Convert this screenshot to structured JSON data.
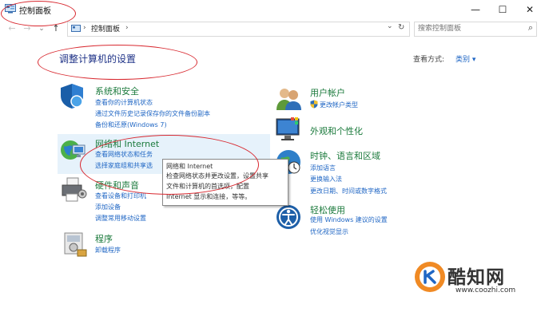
{
  "window": {
    "title": "控制面板",
    "minimize_glyph": "—",
    "maximize_glyph": "☐",
    "close_glyph": "✕"
  },
  "nav": {
    "back_glyph": "←",
    "forward_glyph": "→",
    "recent_glyph": "⌄",
    "up_glyph": "↑",
    "address_root_chevron": "›",
    "address_path": "控制面板",
    "address_chevron": "›",
    "address_dropdown_glyph": "⌄",
    "refresh_glyph": "↻",
    "search_placeholder": "搜索控制面板",
    "search_glyph": "⌕"
  },
  "main": {
    "heading": "调整计算机的设置",
    "view_by_label": "查看方式:",
    "view_by_value": "类别 ▾"
  },
  "left_categories": [
    {
      "title": "系统和安全",
      "links": [
        "查看你的计算机状态",
        "通过文件历史记录保存你的文件备份副本",
        "备份和还原(Windows 7)"
      ]
    },
    {
      "title": "网络和 Internet",
      "links": [
        "查看网络状态和任务",
        "选择家庭组和共享选"
      ]
    },
    {
      "title": "硬件和声音",
      "links": [
        "查看设备和打印机",
        "添加设备",
        "调整常用移动设置"
      ]
    },
    {
      "title": "程序",
      "links": [
        "卸载程序"
      ]
    }
  ],
  "right_categories": [
    {
      "title": "用户帐户",
      "links": [
        "更改帐户类型"
      ]
    },
    {
      "title": "外观和个性化",
      "links": []
    },
    {
      "title": "时钟、语言和区域",
      "links": [
        "添加语言",
        "更换输入法",
        "更改日期、时间或数字格式"
      ]
    },
    {
      "title": "轻松使用",
      "links": [
        "使用 Windows 建议的设置",
        "优化视觉显示"
      ]
    }
  ],
  "tooltip": {
    "lines": [
      "网络和 Internet",
      "检查网络状态并更改设置，设置共享",
      "文件和计算机的首选项，配置",
      "Internet 显示和连接，等等。"
    ]
  },
  "watermark": {
    "name": "酷知网",
    "url": "www.coozhi.com"
  },
  "colors": {
    "heading": "#1e3287",
    "category_title": "#1b7a3c",
    "link": "#1f66c4",
    "annotation": "#d8282f",
    "hover": "#e6f2fb"
  }
}
